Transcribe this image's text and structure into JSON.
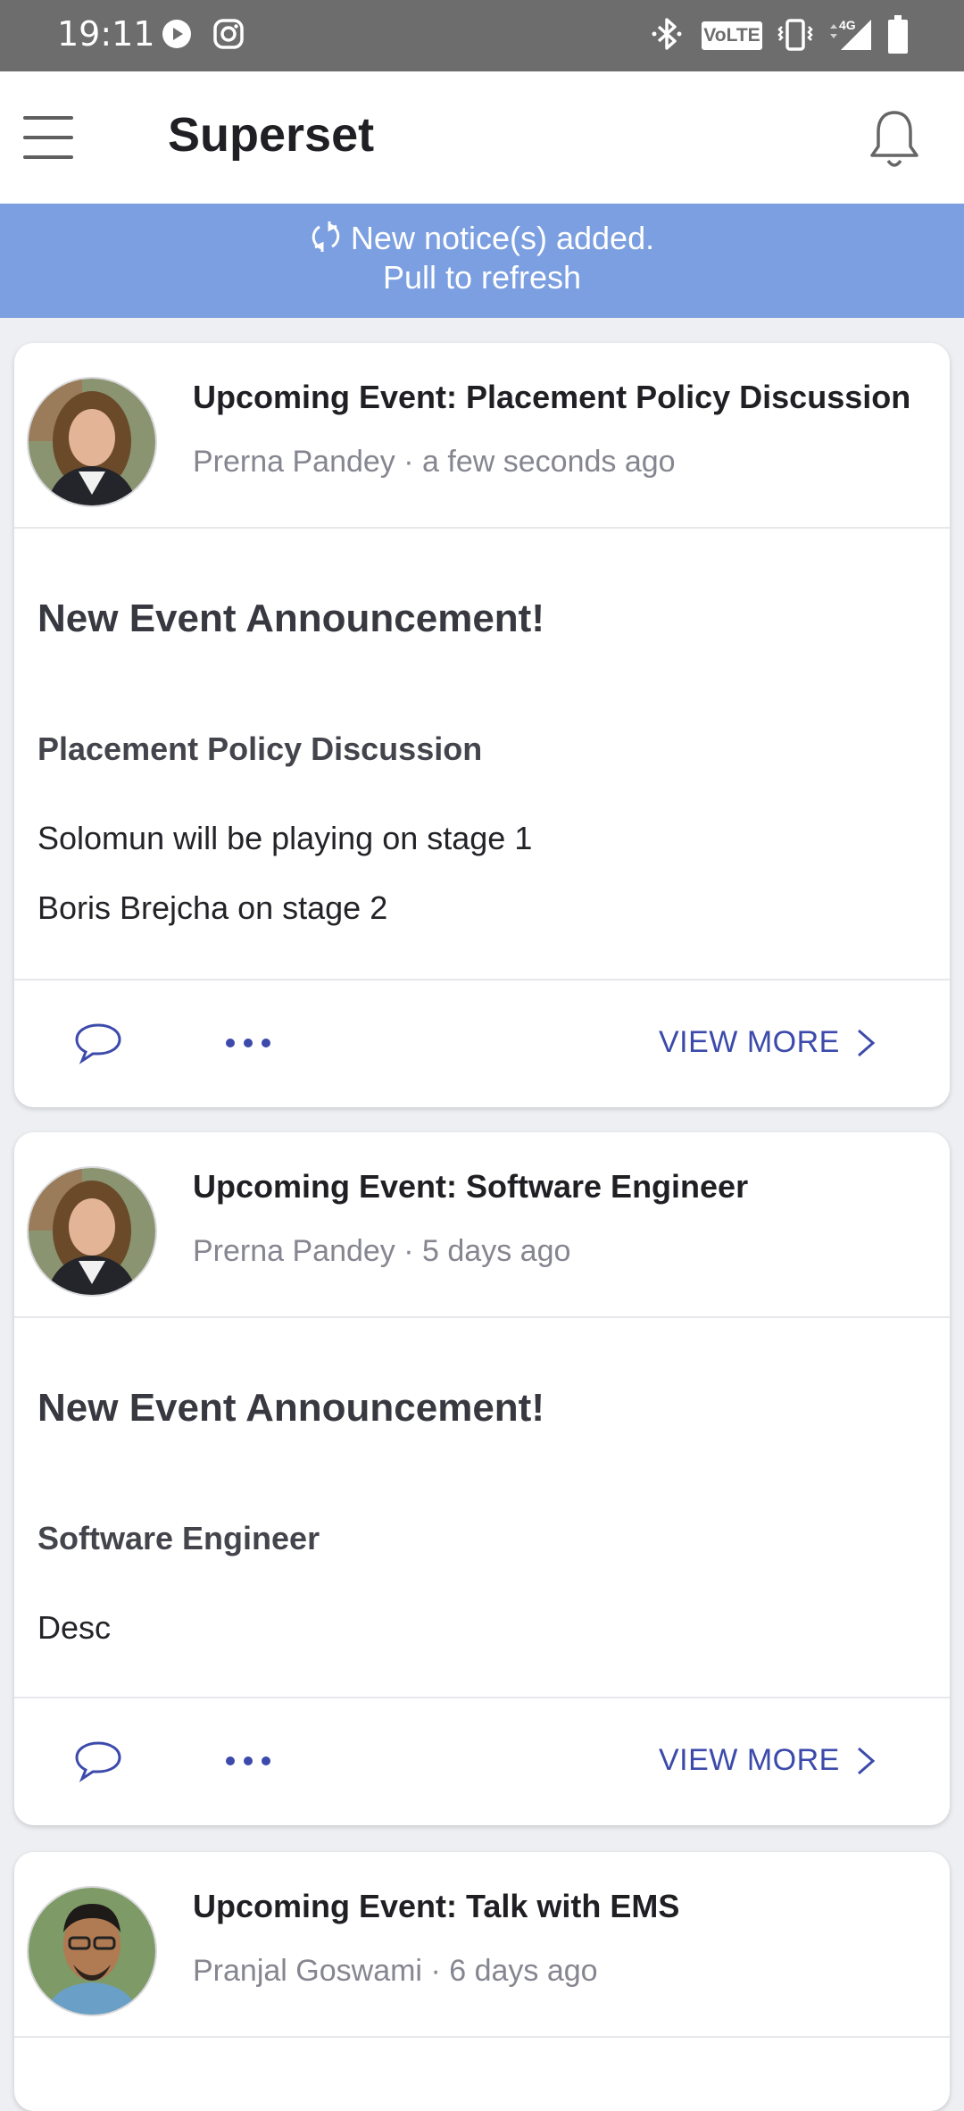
{
  "status_bar": {
    "time": "19:11",
    "network": "4G",
    "volte": "VoLTE"
  },
  "app_bar": {
    "title": "Superset"
  },
  "notice": {
    "line1": "New notice(s) added.",
    "line2": "Pull to refresh"
  },
  "icons": {
    "menu": "hamburger-menu-icon",
    "bell": "bell-icon",
    "refresh": "refresh-icon",
    "comment": "comment-icon",
    "more": "more-horizontal-icon",
    "chevron": "chevron-right-icon"
  },
  "colors": {
    "accent": "#3c4aab",
    "notice_bg": "#7b9fe0",
    "status_bar": "#6d6d6d"
  },
  "cards": [
    {
      "title": "Upcoming Event: Placement Policy Discussion",
      "author": "Prerna Pandey",
      "time": "a few seconds ago",
      "announcement": "New Event Announcement!",
      "subject": "Placement Policy Discussion",
      "lines": [
        "Solomun will be playing on stage 1",
        "Boris Brejcha on stage 2"
      ],
      "view_more": "VIEW MORE"
    },
    {
      "title": "Upcoming Event: Software Engineer",
      "author": "Prerna Pandey",
      "time": "5 days ago",
      "announcement": "New Event Announcement!",
      "subject": "Software Engineer",
      "lines": [
        "Desc"
      ],
      "view_more": "VIEW MORE"
    },
    {
      "title": "Upcoming Event: Talk with EMS",
      "author": "Pranjal Goswami",
      "time": "6 days ago"
    }
  ],
  "meta_separator": "·"
}
